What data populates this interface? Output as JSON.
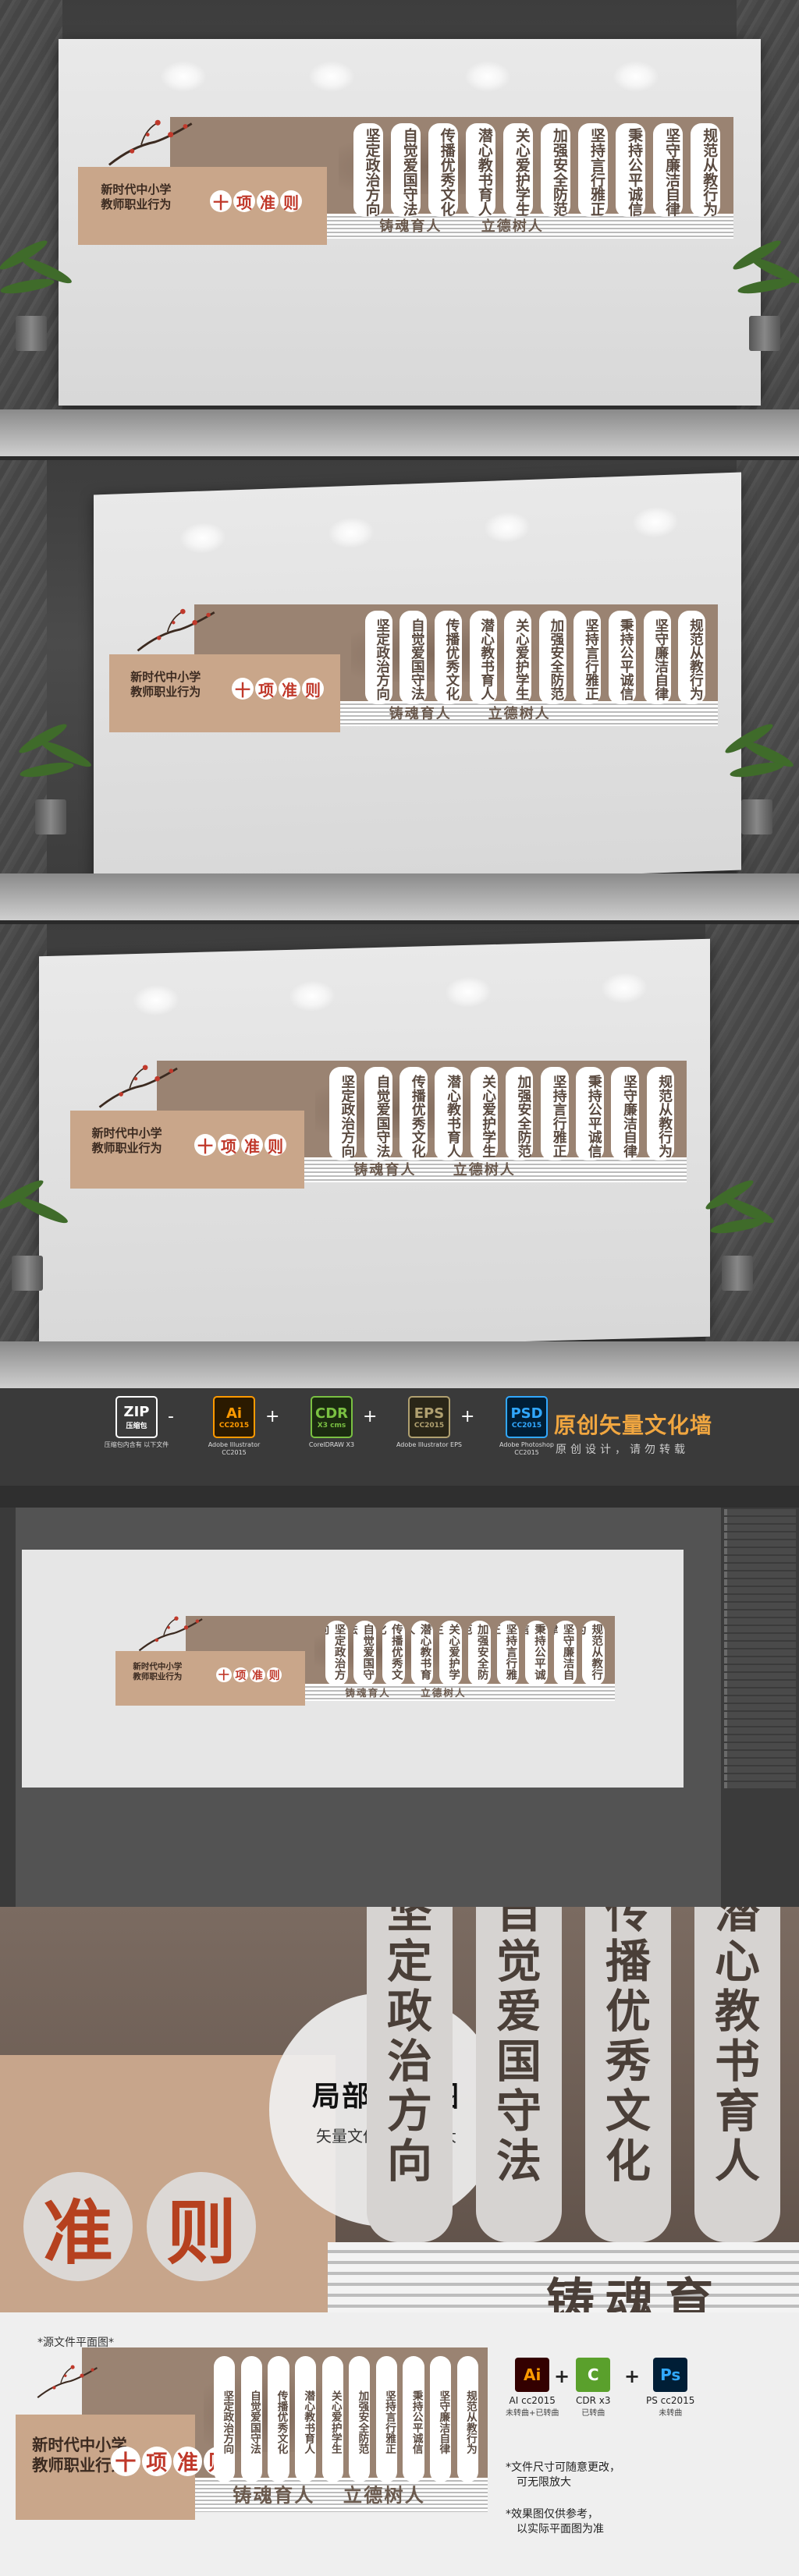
{
  "board": {
    "title_line1": "新时代中小学",
    "title_line2": "教师职业行为",
    "highlight": [
      "十",
      "项",
      "准",
      "则"
    ],
    "pillars": [
      "坚定政治方向",
      "自觉爱国守法",
      "传播优秀文化",
      "潜心教书育人",
      "关心爱护学生",
      "加强安全防范",
      "坚持言行雅正",
      "秉持公平诚信",
      "坚守廉洁自律",
      "规范从教行为"
    ],
    "slogan_left": "铸魂育人",
    "slogan_right": "立德树人"
  },
  "formats": [
    {
      "icon": "ZIP",
      "label": "压缩包",
      "sub": "压缩包内含有\n以下文件",
      "color": "#ffffff",
      "bg": "#3a3a3a",
      "border": "#ffffff"
    },
    {
      "icon": "Ai",
      "label": "CC2015",
      "sub": "Adobe Illustrator\nCC2015",
      "color": "#ff9a00",
      "bg": "#2b1a00",
      "border": "#ff9a00"
    },
    {
      "icon": "CDR",
      "label": "X3 cms",
      "sub": "CorelDRAW\nX3",
      "color": "#7ac142",
      "bg": "#1b2b10",
      "border": "#7ac142"
    },
    {
      "icon": "EPS",
      "label": "CC2015",
      "sub": "Adobe Illustrator\nEPS",
      "color": "#b0a070",
      "bg": "#2a2618",
      "border": "#b0a070"
    },
    {
      "icon": "PSD",
      "label": "CC2015",
      "sub": "Adobe Photoshop\nCC2015",
      "color": "#31a8ff",
      "bg": "#001e36",
      "border": "#31a8ff"
    }
  ],
  "format_ops": [
    "-",
    "+",
    "+",
    "+"
  ],
  "brand": {
    "title": "原创矢量文化墙",
    "subtitle": "原创设计，请勿转载"
  },
  "zoom": {
    "badge_title": "局部放大图",
    "badge_subtitle": "矢量文件可无限放大",
    "pillars": [
      "坚定政治方向",
      "自觉爱国守法",
      "传播优秀文化",
      "潜心教书育人"
    ],
    "bottom_text": "铸魂育",
    "red_text": [
      "准",
      "则"
    ]
  },
  "footer": {
    "label": "*源文件平面图*",
    "software": [
      {
        "icon": "Ai",
        "name": "AI cc2015",
        "sub": "未转曲+已转曲",
        "color": "#ff9a00",
        "bg": "#330000"
      },
      {
        "icon": "C",
        "name": "CDR x3",
        "sub": "已转曲",
        "color": "#ffffff",
        "bg": "#5aa02c"
      },
      {
        "icon": "Ps",
        "name": "PS cc2015",
        "sub": "未转曲",
        "color": "#31a8ff",
        "bg": "#001e36"
      }
    ],
    "ops": [
      "+",
      "+"
    ],
    "note1_line1": "*文件尺寸可随意更改，",
    "note1_line2": "可无限放大",
    "note2_line1": "*效果图仅供参考，",
    "note2_line2": "以实际平面图为准"
  }
}
